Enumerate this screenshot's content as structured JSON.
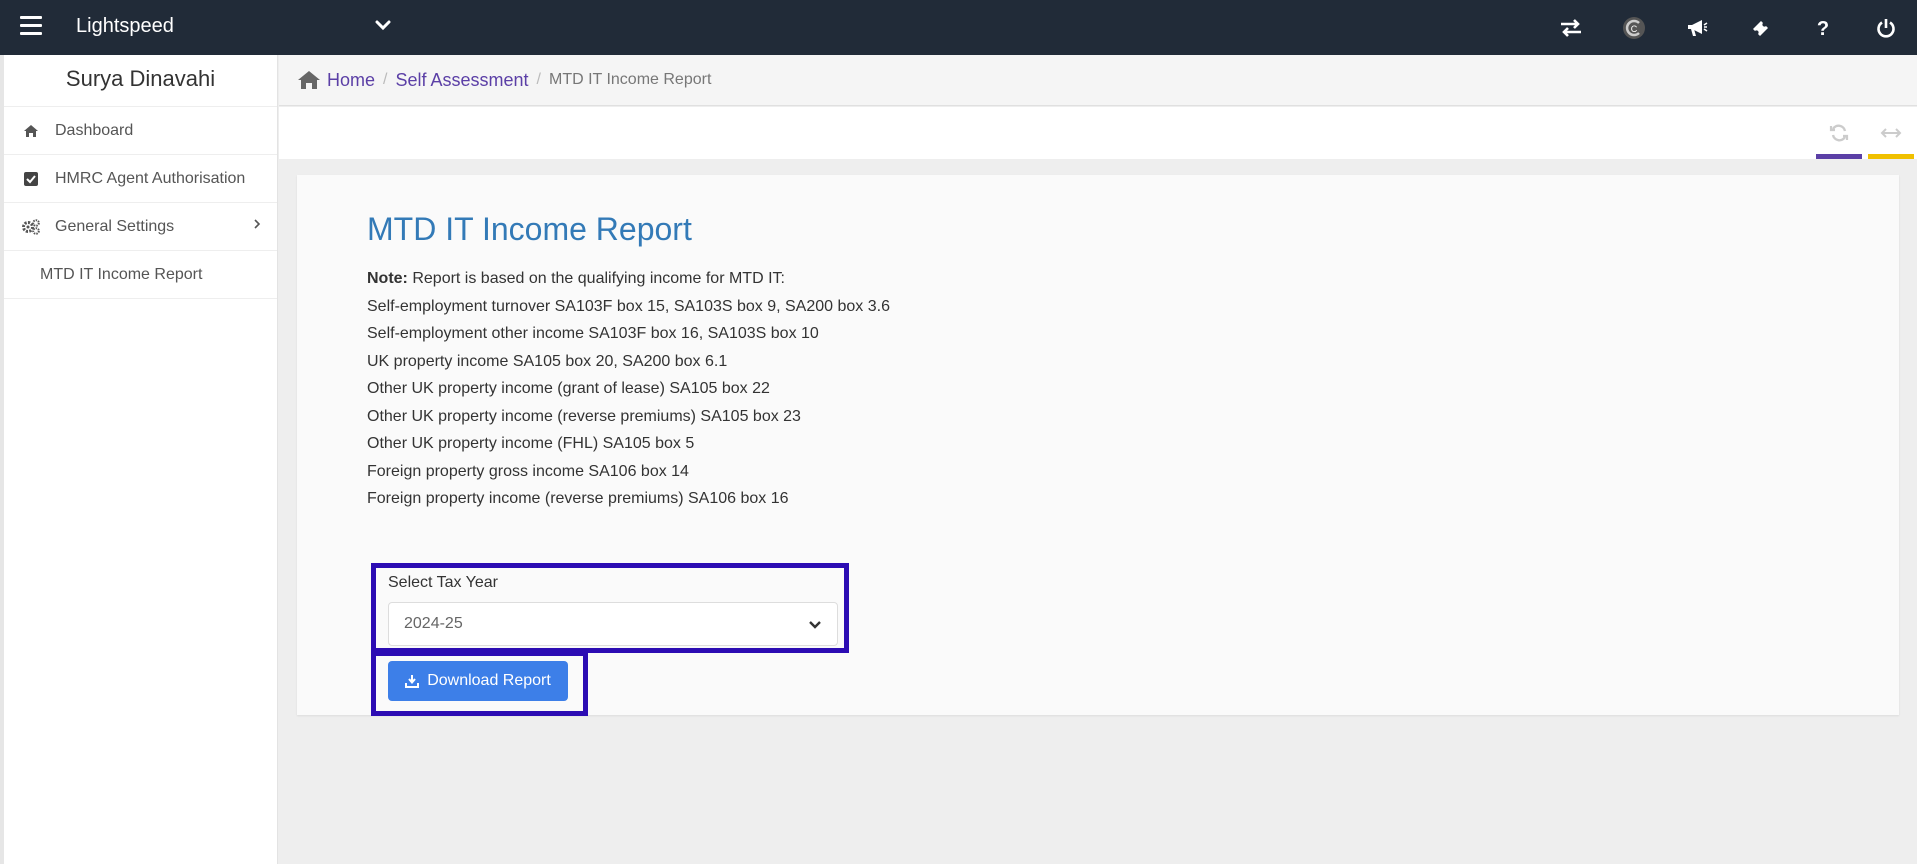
{
  "topbar": {
    "app_title": "Lightspeed",
    "icons": [
      "swap-icon",
      "c-logo-icon",
      "megaphone-icon",
      "ticket-icon",
      "help-icon",
      "power-icon"
    ]
  },
  "sidebar": {
    "user_name": "Surya Dinavahi",
    "items": [
      {
        "label": "Dashboard",
        "icon": "home-icon"
      },
      {
        "label": "HMRC Agent Authorisation",
        "icon": "checkbox-icon"
      },
      {
        "label": "General Settings",
        "icon": "gears-icon"
      },
      {
        "label": "MTD IT Income Report"
      }
    ]
  },
  "breadcrumb": {
    "home": "Home",
    "section": "Self Assessment",
    "current": "MTD IT Income Report"
  },
  "toolbar": {
    "accent_purple": "#5b3fa6",
    "accent_yellow": "#f0c000"
  },
  "report": {
    "title": "MTD IT Income Report",
    "note_label": "Note:",
    "note_text": " Report is based on the qualifying income for MTD IT:",
    "lines": [
      "Self-employment turnover SA103F box 15, SA103S box 9, SA200 box 3.6",
      "Self-employment other income SA103F box 16, SA103S box 10",
      "UK property income SA105 box 20, SA200 box 6.1",
      "Other UK property income (grant of lease) SA105 box 22",
      "Other UK property income (reverse premiums) SA105 box 23",
      "Other UK property income (FHL) SA105 box 5",
      "Foreign property gross income SA106 box 14",
      "Foreign property income (reverse premiums) SA106 box 16"
    ],
    "tax_year_label": "Select Tax Year",
    "tax_year_value": "2024-25",
    "download_label": "Download Report"
  }
}
